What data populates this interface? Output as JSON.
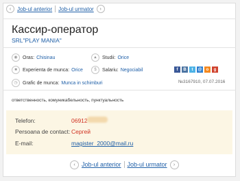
{
  "nav": {
    "prev_label": "Job-ul anterior",
    "next_label": "Job-ul urmator",
    "prev_icon": "‹",
    "next_icon": "›"
  },
  "job": {
    "title": "Кассир-оператор",
    "company": "SRL\"PLAY MANIA\""
  },
  "details": {
    "city_label": "Oras:",
    "city": "Chisinau",
    "studies_label": "Studii:",
    "studies": "Orice",
    "experience_label": "Experienta de munca:",
    "experience": "Orice",
    "salary_label": "Salariu:",
    "salary": "Negociabil",
    "schedule_label": "Grafic de munca:",
    "schedule": "Munca in schimburi"
  },
  "social": [
    {
      "name": "facebook",
      "glyph": "f",
      "color": "#3b5998"
    },
    {
      "name": "vk",
      "glyph": "B",
      "color": "#4c75a3"
    },
    {
      "name": "twitter",
      "glyph": "t",
      "color": "#4cb2e6"
    },
    {
      "name": "mail",
      "glyph": "@",
      "color": "#2e7fd1"
    },
    {
      "name": "odnoklassniki",
      "glyph": "o",
      "color": "#f5891f"
    },
    {
      "name": "google-plus",
      "glyph": "g",
      "color": "#d0432f"
    }
  ],
  "meta": {
    "ref_date": "№3167910, 07.07.2016"
  },
  "description": "ответственность, комуникабельность, пунктуальность",
  "contact": {
    "phone_label": "Telefon:",
    "phone": "06912",
    "person_label": "Persoana de contact:",
    "person": "Сергей",
    "email_label": "E-mail:",
    "email": "magister_2000@mail.ru"
  },
  "colors": {
    "link": "#2060a8",
    "accent_red": "#d03020",
    "contact_bg": "#fcf6e4"
  }
}
